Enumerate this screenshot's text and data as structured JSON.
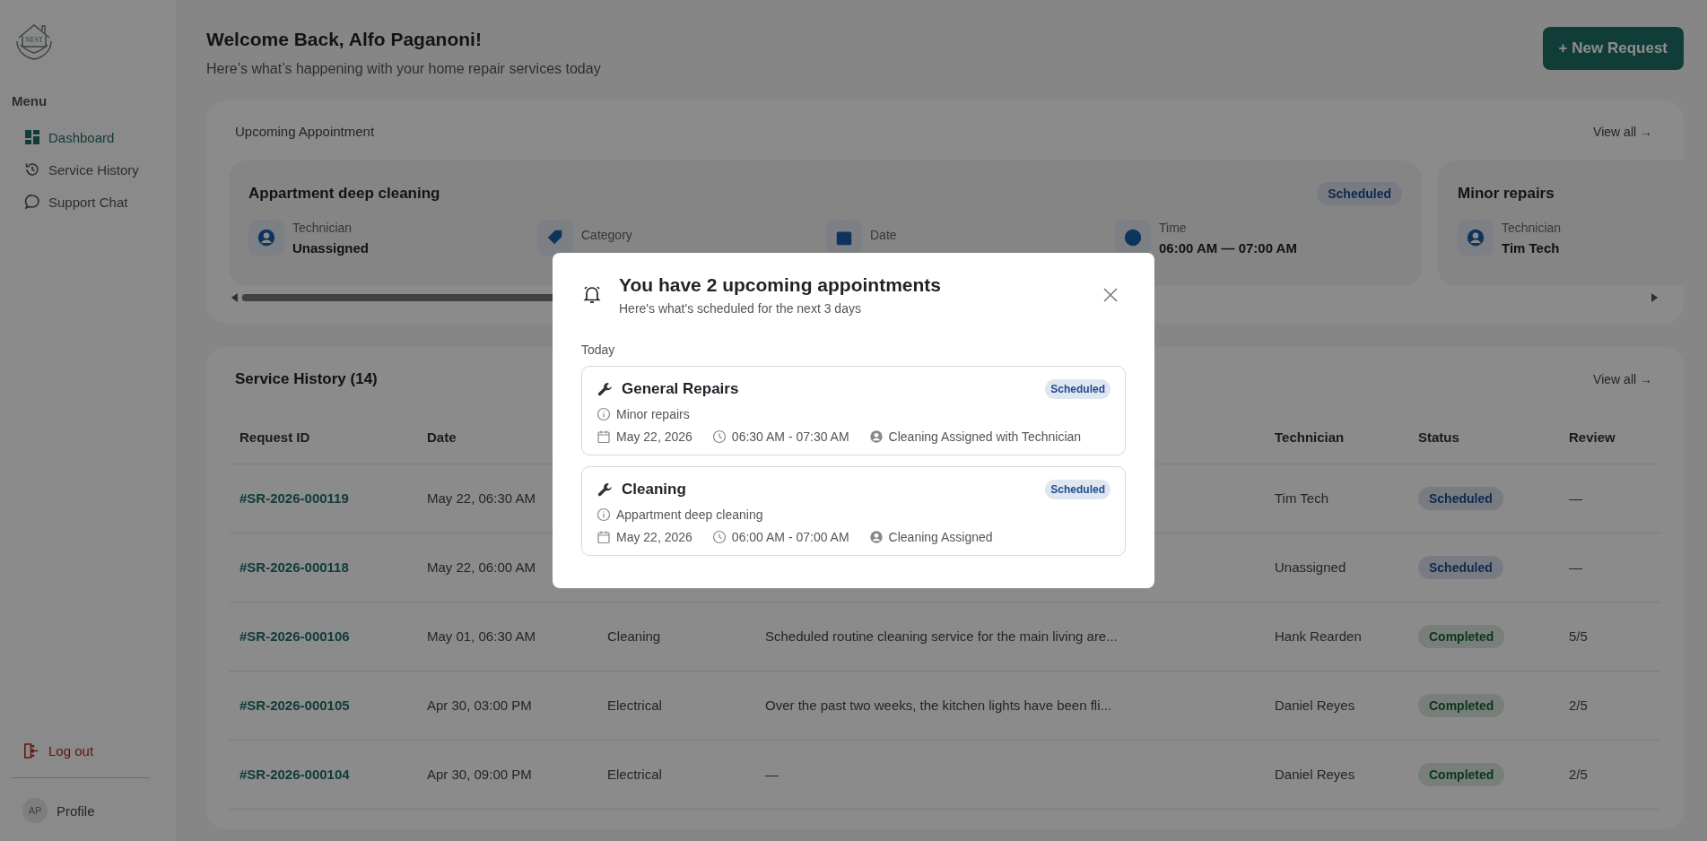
{
  "sidebar": {
    "logo_text": "NEST",
    "menu_label": "Menu",
    "items": [
      {
        "label": "Dashboard",
        "selected": true
      },
      {
        "label": "Service History",
        "selected": false
      },
      {
        "label": "Support Chat",
        "selected": false
      }
    ],
    "logout": "Log out",
    "profile": {
      "initials": "AP",
      "label": "Profile"
    }
  },
  "header": {
    "title": "Welcome Back, Alfo Paganoni!",
    "subtitle": "Here’s what’s happening with your home repair services today",
    "new_request_button": "+ New Request"
  },
  "upcoming": {
    "title": "Upcoming Appointment",
    "view_all": "View all →",
    "cards": [
      {
        "title": "Appartment deep cleaning",
        "status": "Scheduled",
        "kind": "scheduled",
        "fields": [
          {
            "kind": "technician",
            "label": "Technician",
            "value": "Unassigned"
          },
          {
            "kind": "category",
            "label": "Category"
          },
          {
            "kind": "date",
            "label": "Date"
          },
          {
            "kind": "time",
            "label": "Time",
            "value": "06:00 AM — 07:00 AM"
          }
        ]
      },
      {
        "title": "Minor repairs",
        "fields": [
          {
            "kind": "technician",
            "label": "Technician",
            "value": "Tim Tech"
          }
        ]
      }
    ]
  },
  "service_history": {
    "title": "Service History (14)",
    "view_all": "View all →",
    "columns": {
      "request_id": "Request ID",
      "date": "Date",
      "technician": "Technician",
      "status": "Status",
      "review": "Review"
    },
    "rows": [
      {
        "request_id": "#SR-2026-000119",
        "date": "May 22, 06:30 AM",
        "technician": "Tim Tech",
        "status": "Scheduled",
        "kind": "scheduled",
        "review": "—"
      },
      {
        "request_id": "#SR-2026-000118",
        "date": "May 22, 06:00 AM",
        "technician": "Unassigned",
        "status": "Scheduled",
        "kind": "scheduled",
        "review": "—"
      },
      {
        "request_id": "#SR-2026-000106",
        "date": "May 01, 06:30 AM",
        "column_3": "Cleaning",
        "column_4": "Scheduled routine cleaning service for the main living are...",
        "technician": "Hank Rearden",
        "status": "Completed",
        "kind": "completed",
        "review": "5/5"
      },
      {
        "request_id": "#SR-2026-000105",
        "date": "Apr 30, 03:00 PM",
        "column_3": "Electrical",
        "column_4": "Over the past two weeks, the kitchen lights have been fli...",
        "technician": "Daniel Reyes",
        "status": "Completed",
        "kind": "completed",
        "review": "2/5"
      },
      {
        "request_id": "#SR-2026-000104",
        "date": "Apr 30, 09:00 PM",
        "column_3": "Electrical",
        "column_4": "—",
        "technician": "Daniel Reyes",
        "status": "Completed",
        "kind": "completed",
        "review": "2/5"
      }
    ]
  },
  "modal": {
    "title": "You have 2 upcoming appointments",
    "subtitle": "Here's what's scheduled for the next 3 days",
    "group_label": "Today",
    "appointments": [
      {
        "title": "General Repairs",
        "status": "Scheduled",
        "color": "#1e4b8f",
        "description": "Minor repairs",
        "date": "May 22, 2026",
        "time": "06:30 AM - 07:30 AM",
        "assignee": "Cleaning Assigned with Technician"
      },
      {
        "title": "Cleaning",
        "status": "Scheduled",
        "color": "#1e4b8f",
        "description": "Appartment deep cleaning",
        "date": "May 22, 2026",
        "time": "06:00 AM - 07:00 AM",
        "assignee": "Cleaning Assigned"
      }
    ]
  }
}
